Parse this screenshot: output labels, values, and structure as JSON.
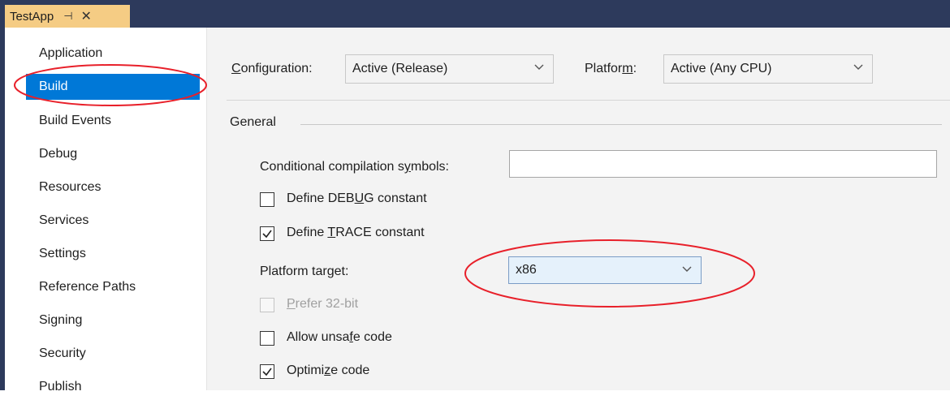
{
  "tab": {
    "title": "TestApp",
    "pin_glyph": "⊣",
    "close_glyph": "✕"
  },
  "sidebar": {
    "items": [
      {
        "label": "Application",
        "selected": false
      },
      {
        "label": "Build",
        "selected": true
      },
      {
        "label": "Build Events",
        "selected": false
      },
      {
        "label": "Debug",
        "selected": false
      },
      {
        "label": "Resources",
        "selected": false
      },
      {
        "label": "Services",
        "selected": false
      },
      {
        "label": "Settings",
        "selected": false
      },
      {
        "label": "Reference Paths",
        "selected": false
      },
      {
        "label": "Signing",
        "selected": false
      },
      {
        "label": "Security",
        "selected": false
      },
      {
        "label": "Publish",
        "selected": false
      }
    ]
  },
  "toolbar": {
    "configuration_label_pre": "",
    "configuration_label_u": "C",
    "configuration_label_post": "onfiguration:",
    "configuration_value": "Active (Release)",
    "platform_label_pre": "Platfor",
    "platform_label_u": "m",
    "platform_label_post": ":",
    "platform_value": "Active (Any CPU)"
  },
  "general": {
    "title": "General",
    "symbols_label_pre": "Conditional compilation s",
    "symbols_label_u": "y",
    "symbols_label_post": "mbols:",
    "symbols_value": "",
    "define_debug_pre": "Define DEB",
    "define_debug_u": "U",
    "define_debug_post": "G constant",
    "define_debug_checked": false,
    "define_trace_pre": "Define ",
    "define_trace_u": "T",
    "define_trace_post": "RACE constant",
    "define_trace_checked": true,
    "platform_target_pre": "Platform tar",
    "platform_target_u": "g",
    "platform_target_post": "et:",
    "platform_target_value": "x86",
    "prefer32_pre": "",
    "prefer32_u": "P",
    "prefer32_post": "refer 32-bit",
    "prefer32_checked": false,
    "unsafe_pre": "Allow unsa",
    "unsafe_u": "f",
    "unsafe_post": "e code",
    "unsafe_checked": false,
    "optimize_pre": "Optimi",
    "optimize_u": "z",
    "optimize_post": "e code",
    "optimize_checked": true
  },
  "colors": {
    "frame": "#2d3a5c",
    "tab": "#f5cc84",
    "selected": "#0078d7",
    "annotation": "#e8202a",
    "content_bg": "#f3f3f3"
  },
  "icons": [
    "pin-icon",
    "close-icon",
    "chevron-down-icon",
    "checkmark-icon"
  ]
}
